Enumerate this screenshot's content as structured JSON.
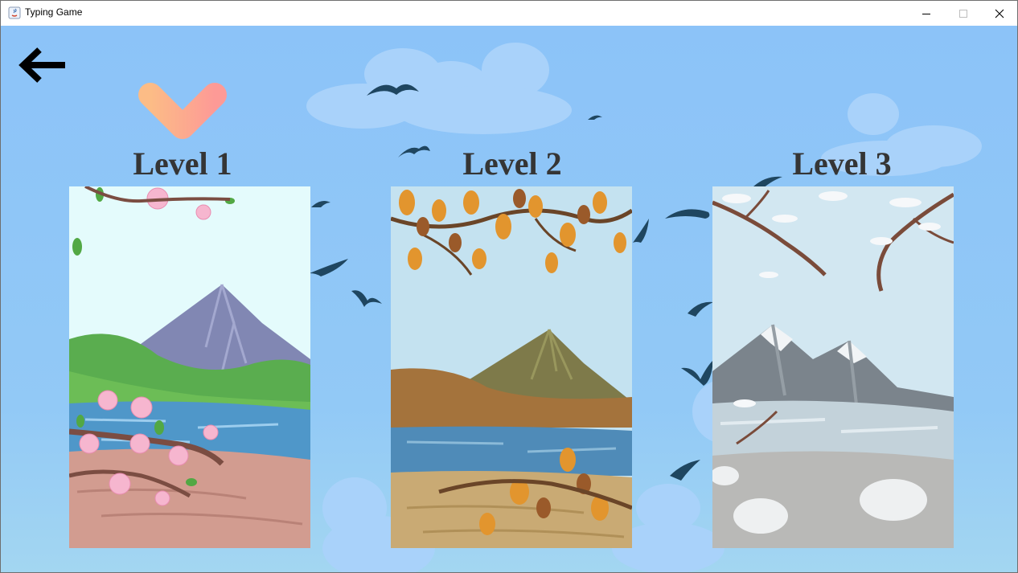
{
  "window": {
    "title": "Typing Game"
  },
  "controls": [
    "minimize-icon",
    "maximize-icon",
    "close-icon"
  ],
  "back_icon": "arrow-left-icon",
  "selector_icon": "chevron-down-icon",
  "levels": [
    {
      "label": "Level 1",
      "theme": "spring"
    },
    {
      "label": "Level 2",
      "theme": "autumn"
    },
    {
      "label": "Level 3",
      "theme": "winter"
    }
  ],
  "colors": {
    "sky": "#8cc3f8",
    "title_text": "#353535",
    "selector_start": "#fcbc86",
    "selector_end": "#fd9a96"
  }
}
